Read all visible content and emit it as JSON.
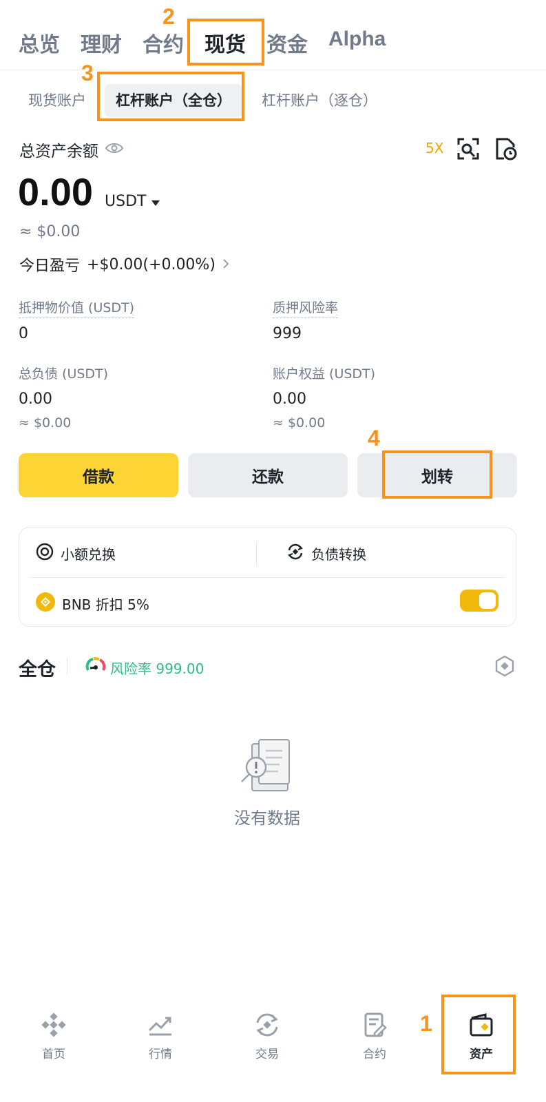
{
  "top_tabs": [
    "总览",
    "理财",
    "合约",
    "现货",
    "资金",
    "Alpha"
  ],
  "sub_tabs": [
    "现货账户",
    "杠杆账户（全仓）",
    "杠杆账户（逐仓）"
  ],
  "balance": {
    "title": "总资产余额",
    "leverage": "5X",
    "value": "0.00",
    "unit": "USDT",
    "approx": "≈ $0.00",
    "pnl_label": "今日盈亏",
    "pnl_value": "+$0.00(+0.00%)"
  },
  "stats": {
    "collateral_label": "抵押物价值 (USDT)",
    "collateral_value": "0",
    "risk_label": "质押风险率",
    "risk_value": "999",
    "debt_label": "总负债 (USDT)",
    "debt_value": "0.00",
    "debt_approx": "≈ $0.00",
    "equity_label": "账户权益 (USDT)",
    "equity_value": "0.00",
    "equity_approx": "≈ $0.00"
  },
  "actions": {
    "borrow": "借款",
    "repay": "还款",
    "transfer": "划转"
  },
  "tools": {
    "small_convert": "小额兑换",
    "debt_convert": "负债转换",
    "bnb_discount": "BNB 折扣 5%",
    "bnb_discount_on": true
  },
  "cross": {
    "title": "全仓",
    "risk": "风险率 999.00"
  },
  "empty": "没有数据",
  "bottom_nav": [
    "首页",
    "行情",
    "交易",
    "合约",
    "资产"
  ],
  "callouts": [
    "1",
    "2",
    "3",
    "4"
  ],
  "colors": {
    "primary": "#fcd535",
    "accent_orange": "#f7931a",
    "positive": "#2ebd85",
    "muted": "#707a8a"
  }
}
